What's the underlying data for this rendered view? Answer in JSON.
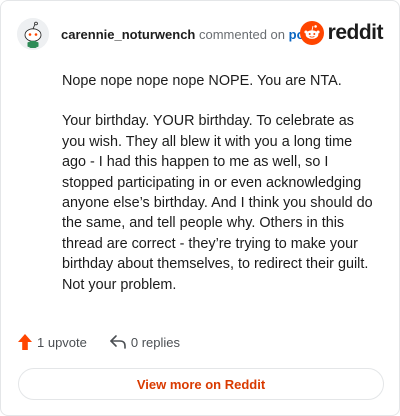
{
  "header": {
    "username": "carennie_noturwench",
    "action_text": "commented on",
    "post_link": "post",
    "brand": "reddit"
  },
  "comment": {
    "paragraphs": [
      "Nope nope nope nope NOPE. You are NTA.",
      "Your birthday. YOUR birthday. To celebrate as you wish. They all blew it with you a long time ago - I had this happen to me as well, so I stopped participating in or even acknowledging anyone else’s birthday. And I think you should do the same, and tell people why. Others in this thread are correct - they’re trying to make your birthday about themselves, to redirect their guilt. Not your problem."
    ]
  },
  "actions": {
    "upvote_label": "1 upvote",
    "replies_label": "0 replies"
  },
  "footer": {
    "view_more_label": "View more on Reddit"
  },
  "colors": {
    "brand_orange": "#ff4500",
    "upvote_orange": "#ff4500",
    "link_blue": "#0a66c2",
    "view_more_text": "#d93a00"
  },
  "icons": [
    "avatar-snoo-icon",
    "reddit-logo-icon",
    "upvote-arrow-icon",
    "reply-arrow-icon"
  ]
}
